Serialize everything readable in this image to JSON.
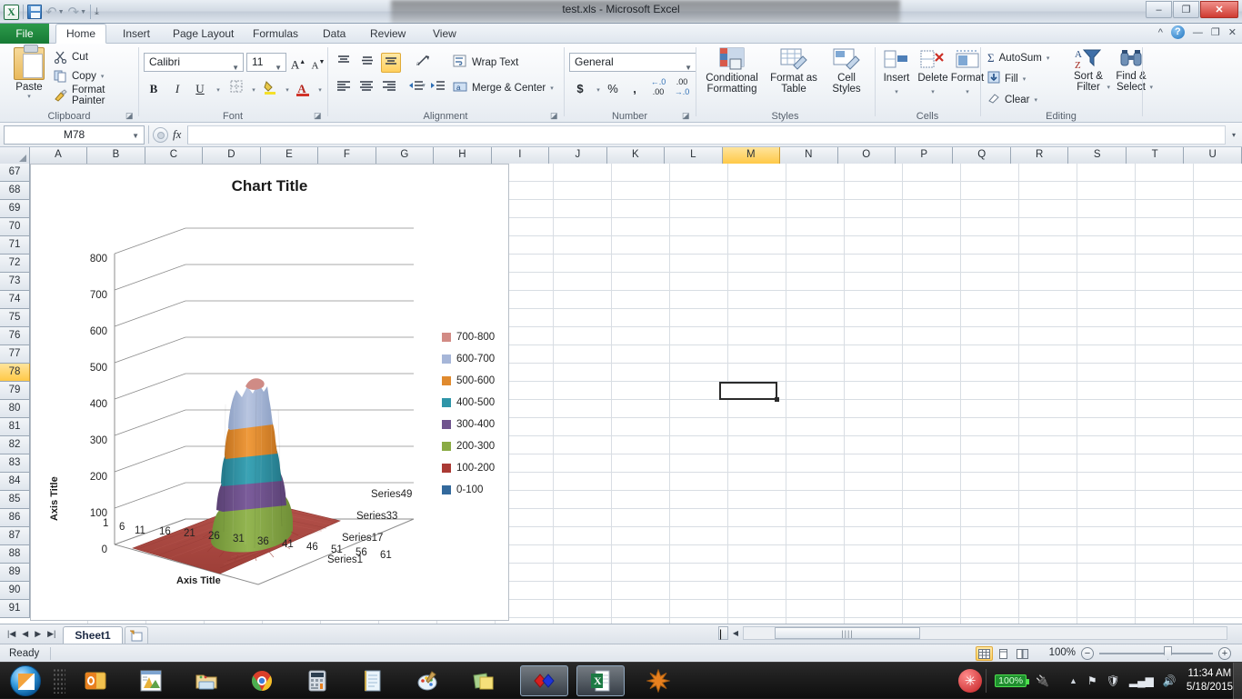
{
  "window": {
    "title": "test.xls  -  Microsoft Excel",
    "minimize": "–",
    "restore": "❐",
    "close": "✕"
  },
  "quick_access": {
    "logo": "excel-logo",
    "save": "save-icon",
    "undo": "↶",
    "redo": "↷",
    "customize": "▾"
  },
  "ribbon": {
    "tabs": [
      {
        "label": "File",
        "active": false
      },
      {
        "label": "Home",
        "active": true
      },
      {
        "label": "Insert",
        "active": false
      },
      {
        "label": "Page Layout",
        "active": false
      },
      {
        "label": "Formulas",
        "active": false
      },
      {
        "label": "Data",
        "active": false
      },
      {
        "label": "Review",
        "active": false
      },
      {
        "label": "View",
        "active": false
      }
    ],
    "help": "?",
    "minimize_ribbon": "^",
    "win_min": "—",
    "win_restore": "❐",
    "win_close": "✕",
    "groups": {
      "clipboard": {
        "label": "Clipboard",
        "paste": "Paste",
        "paste_caret": "▾",
        "cut": "Cut",
        "copy": "Copy",
        "copy_caret": "▾",
        "format_painter": "Format Painter",
        "launcher": "◪"
      },
      "font": {
        "label": "Font",
        "font_name": "Calibri",
        "font_size": "11",
        "grow_font": "A",
        "shrink_font": "A",
        "bold": "B",
        "italic": "I",
        "underline": "U",
        "underline_caret": "▾",
        "borders_caret": "▾",
        "fill_color": "A",
        "font_color": "A",
        "launcher": "◪"
      },
      "alignment": {
        "label": "Alignment",
        "orientation_caret": "▾",
        "wrap_text": "Wrap Text",
        "merge_center": "Merge & Center",
        "merge_caret": "▾",
        "launcher": "◪"
      },
      "number": {
        "label": "Number",
        "format": "General",
        "format_caret": "▾",
        "currency": "$",
        "currency_caret": "▾",
        "percent": "%",
        "comma": ",",
        "increase_decimal": ".00",
        "decrease_decimal": ".00",
        "launcher": "◪"
      },
      "styles": {
        "label": "Styles",
        "conditional_formatting": "Conditional Formatting",
        "format_as_table": "Format as Table",
        "cell_styles": "Cell Styles",
        "caret": "▾"
      },
      "cells": {
        "label": "Cells",
        "insert": "Insert",
        "delete": "Delete",
        "format": "Format",
        "caret": "▾"
      },
      "editing": {
        "label": "Editing",
        "autosum": "AutoSum",
        "autosum_sigma": "Σ",
        "fill": "Fill",
        "clear": "Clear",
        "sort_filter": "Sort & Filter",
        "find_select": "Find & Select",
        "caret": "▾"
      }
    }
  },
  "formula_bar": {
    "name_box": "M78",
    "name_box_caret": "▾",
    "fx": "fx",
    "formula": "",
    "expand": "▾"
  },
  "grid": {
    "columns": [
      "A",
      "B",
      "C",
      "D",
      "E",
      "F",
      "G",
      "H",
      "I",
      "J",
      "K",
      "L",
      "M",
      "N",
      "O",
      "P",
      "Q",
      "R",
      "S",
      "T",
      "U"
    ],
    "selected_column": "M",
    "rows": [
      "67",
      "68",
      "69",
      "70",
      "71",
      "72",
      "73",
      "74",
      "75",
      "76",
      "77",
      "78",
      "79",
      "80",
      "81",
      "82",
      "83",
      "84",
      "85",
      "86",
      "87",
      "88",
      "89",
      "90",
      "91"
    ],
    "selected_row": "78",
    "selected_cell": "M78"
  },
  "chart_data": {
    "type": "surface",
    "title": "Chart Title",
    "xlabel": "Axis Title",
    "ylabel": "Axis Title",
    "zlabel": "",
    "ylim": [
      0,
      800
    ],
    "yticks": [
      "800",
      "700",
      "600",
      "500",
      "400",
      "300",
      "200",
      "100",
      "0"
    ],
    "xticks": [
      "1",
      "6",
      "11",
      "16",
      "21",
      "26",
      "31",
      "36",
      "41",
      "46",
      "51",
      "56",
      "61"
    ],
    "series_labels": [
      "Series49",
      "Series33",
      "Series17",
      "Series1"
    ],
    "legend_position": "right",
    "legend": [
      {
        "label": "700-800",
        "color": "#d28b85"
      },
      {
        "label": "600-700",
        "color": "#a6b6d8"
      },
      {
        "label": "500-600",
        "color": "#e08a2e"
      },
      {
        "label": "400-500",
        "color": "#2e95a8"
      },
      {
        "label": "300-400",
        "color": "#70548e"
      },
      {
        "label": "200-300",
        "color": "#8aab44"
      },
      {
        "label": "100-200",
        "color": "#aa3a34"
      },
      {
        "label": "0-100",
        "color": "#33699c"
      }
    ],
    "description": "3D surface plot: flat plateau near 100-200 across a 64x64 grid with a single tall central peak reaching about 780",
    "grid": true,
    "peak_value": 780,
    "base_value": 150
  },
  "sheet_tabs": {
    "first": "|◀",
    "prev": "◀",
    "next": "▶",
    "last": "▶|",
    "tabs": [
      "Sheet1"
    ],
    "new_sheet": "new-sheet"
  },
  "hscroll": {
    "grip": "|",
    "left_arrow": "◀",
    "thumb": "||||"
  },
  "status_bar": {
    "status": "Ready",
    "view_normal": "normal-view",
    "view_layout": "page-layout-view",
    "view_break": "page-break-view",
    "zoom": "100%",
    "zoom_out": "−",
    "zoom_in": "+"
  },
  "taskbar": {
    "start": "start-orb",
    "items": [
      {
        "name": "outlook-icon",
        "active": false
      },
      {
        "name": "chart-app-icon",
        "active": false
      },
      {
        "name": "scanner-folder-icon",
        "active": false
      },
      {
        "name": "chrome-icon",
        "active": false
      },
      {
        "name": "calculator-icon",
        "active": false
      },
      {
        "name": "notepad-icon",
        "active": false
      },
      {
        "name": "paint-icon",
        "active": false
      },
      {
        "name": "sticky-notes-icon",
        "active": false
      },
      {
        "name": "media-app-icon",
        "active": true
      },
      {
        "name": "excel-icon",
        "active": true
      },
      {
        "name": "mathematica-icon",
        "active": false
      }
    ],
    "tray": {
      "show_hidden": "▲",
      "battery": "100%",
      "network": "network-icon",
      "volume": "volume-icon",
      "action_center": "flag-icon",
      "time": "11:34 AM",
      "date": "5/18/2015"
    }
  }
}
